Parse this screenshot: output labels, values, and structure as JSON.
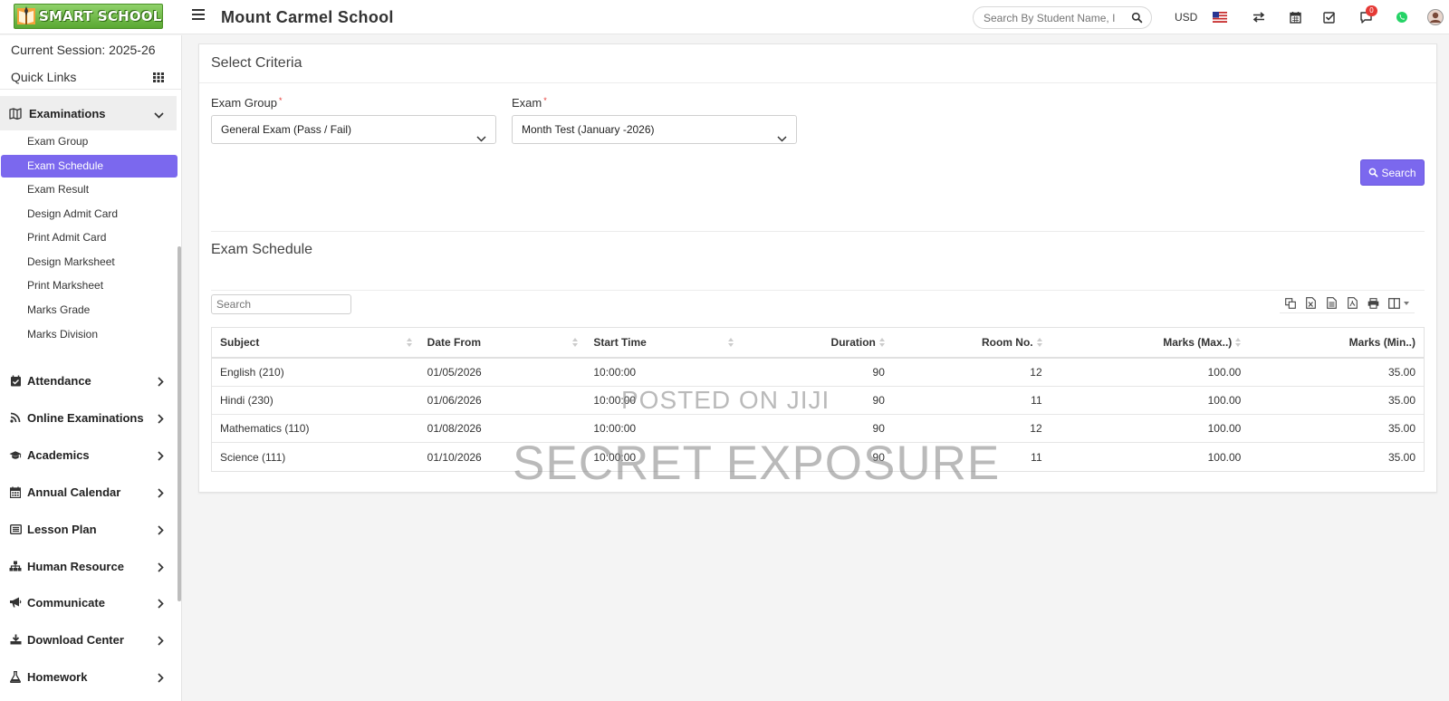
{
  "header": {
    "logo_text": "SMART SCHOOL",
    "school_name": "Mount Carmel School",
    "search_placeholder": "Search By Student Name, I",
    "currency": "USD",
    "notification_count": "0"
  },
  "sidebar": {
    "session": "Current Session: 2025-26",
    "quick_links": "Quick Links",
    "examinations": {
      "label": "Examinations",
      "items": [
        {
          "label": "Exam Group"
        },
        {
          "label": "Exam Schedule",
          "active": true
        },
        {
          "label": "Exam Result"
        },
        {
          "label": "Design Admit Card"
        },
        {
          "label": "Print Admit Card"
        },
        {
          "label": "Design Marksheet"
        },
        {
          "label": "Print Marksheet"
        },
        {
          "label": "Marks Grade"
        },
        {
          "label": "Marks Division"
        }
      ]
    },
    "menus": [
      {
        "label": "Attendance",
        "icon": "calendar-check-icon"
      },
      {
        "label": "Online Examinations",
        "icon": "rss-icon"
      },
      {
        "label": "Academics",
        "icon": "graduation-cap-icon"
      },
      {
        "label": "Annual Calendar",
        "icon": "calendar-icon"
      },
      {
        "label": "Lesson Plan",
        "icon": "list-alt-icon"
      },
      {
        "label": "Human Resource",
        "icon": "sitemap-icon"
      },
      {
        "label": "Communicate",
        "icon": "bullhorn-icon"
      },
      {
        "label": "Download Center",
        "icon": "download-icon"
      },
      {
        "label": "Homework",
        "icon": "flask-icon"
      }
    ]
  },
  "criteria": {
    "title": "Select Criteria",
    "exam_group_label": "Exam Group",
    "exam_group_value": "General Exam (Pass / Fail)",
    "exam_label": "Exam",
    "exam_value": "Month Test (January -2026)",
    "required_mark": "*",
    "search_button": "Search"
  },
  "schedule": {
    "title": "Exam Schedule",
    "search_placeholder": "Search",
    "columns": [
      "Subject",
      "Date From",
      "Start Time",
      "Duration",
      "Room No.",
      "Marks (Max..)",
      "Marks (Min..)"
    ],
    "rows": [
      [
        "English (210)",
        "01/05/2026",
        "10:00:00",
        "90",
        "12",
        "100.00",
        "35.00"
      ],
      [
        "Hindi (230)",
        "01/06/2026",
        "10:00:00",
        "90",
        "11",
        "100.00",
        "35.00"
      ],
      [
        "Mathematics (110)",
        "01/08/2026",
        "10:00:00",
        "90",
        "12",
        "100.00",
        "35.00"
      ],
      [
        "Science (111)",
        "01/10/2026",
        "10:00:00",
        "90",
        "11",
        "100.00",
        "35.00"
      ]
    ]
  },
  "watermark": {
    "line1": "POSTED ON JIJI",
    "line2": "SECRET EXPOSURE"
  },
  "colors": {
    "accent": "#7b68ee",
    "logo_green": "#5aa832",
    "badge_red": "#e53935"
  }
}
